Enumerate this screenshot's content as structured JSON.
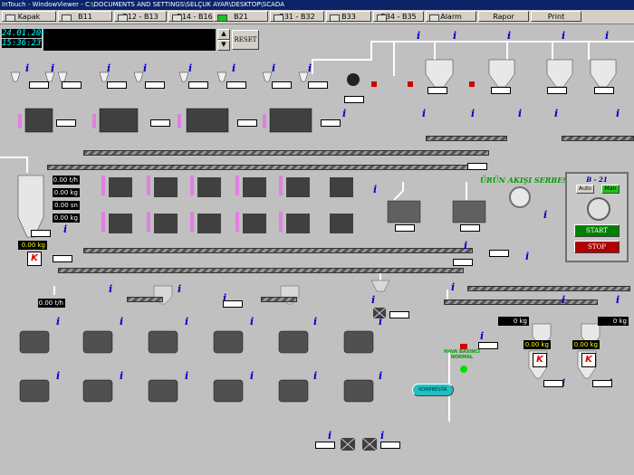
{
  "window": {
    "title": "InTouch - WindowViewer - C:\\DOCUMENTS AND SETTINGS\\SELÇUK AYAR\\DESKTOP\\SCADA"
  },
  "tabs": [
    {
      "label": "Kapak",
      "active": false
    },
    {
      "label": "B11",
      "active": false
    },
    {
      "label": "B12 - B13",
      "active": false
    },
    {
      "label": "B14 - B16",
      "active": false
    },
    {
      "label": "B21",
      "active": true
    },
    {
      "label": "B31 - B32",
      "active": false
    },
    {
      "label": "B33",
      "active": false
    },
    {
      "label": "B34 - B35",
      "active": false
    },
    {
      "label": "Alarm",
      "active": false
    },
    {
      "label": "Rapor",
      "active": false
    },
    {
      "label": "Print",
      "active": false
    }
  ],
  "clock": {
    "date": "24.01.2006",
    "time": "15:36:23"
  },
  "alarm_panel": {
    "reset_label": "RESET"
  },
  "readouts": {
    "flow1": "0.00 t/h",
    "kg1": "0.00 kg",
    "sn1": "0.00 sn",
    "kg2": "0.00 kg",
    "scale_left": "0.00 kg",
    "flow2": "0.00 t/h",
    "kg_right_top1": "0 kg",
    "kg_right_top2": "0 kg",
    "scale_right1": "0.00 kg",
    "scale_right2": "0.00 kg"
  },
  "status": {
    "flow_free": "ÜRÜN AKIŞI SERBEST",
    "air_pressure": "HAVA BASINCI NORMAL",
    "compressor": "KOMPRESÖR"
  },
  "control_panel": {
    "title": "B - 21",
    "auto": "Auto",
    "man": "Man",
    "start": "START",
    "stop": "STOP"
  },
  "colors": {
    "panel_bg": "#c0c0c0",
    "info_blue": "#0000c8",
    "ok_green": "#00a000",
    "start_green": "#008000",
    "stop_red": "#b00000",
    "bin_magenta": "#e080e0"
  }
}
